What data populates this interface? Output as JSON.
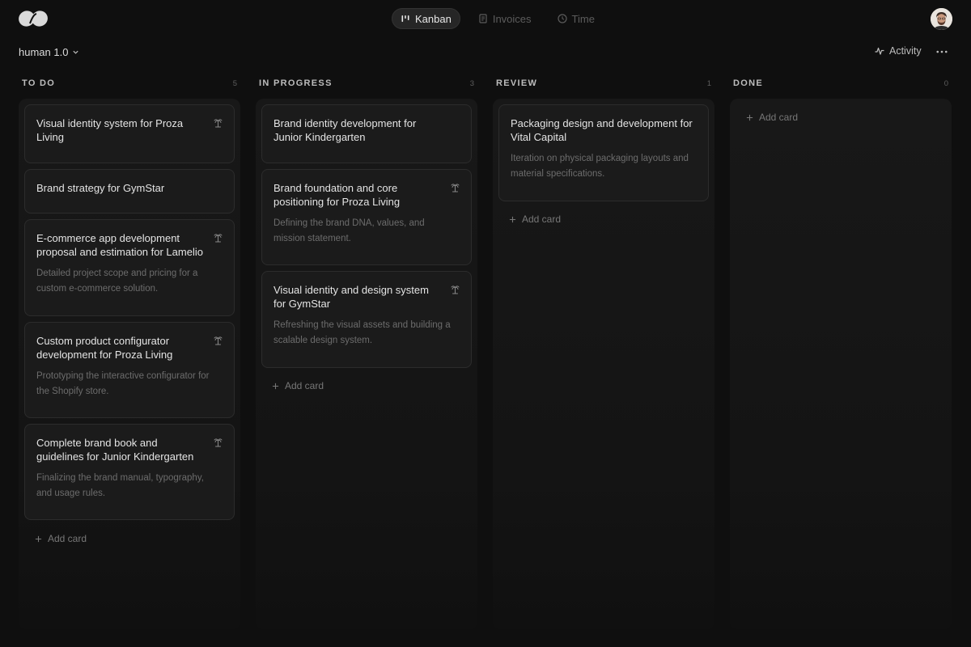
{
  "nav": {
    "kanban": "Kanban",
    "invoices": "Invoices",
    "time": "Time"
  },
  "workspace": {
    "name": "human 1.0"
  },
  "toolbar": {
    "activity": "Activity"
  },
  "columns": [
    {
      "title": "TO DO",
      "count": "5",
      "add_label": "Add card",
      "cards": [
        {
          "title": "Visual identity system for Proza Living",
          "desc": "",
          "icon": "palm-tree-icon"
        },
        {
          "title": "Brand strategy for GymStar",
          "desc": "",
          "icon": ""
        },
        {
          "title": "E-commerce app development proposal and estimation for Lamelio",
          "desc": "Detailed project scope and pricing for a custom e-commerce solution.",
          "icon": "palm-tree-icon"
        },
        {
          "title": "Custom product configurator development for Proza Living",
          "desc": "Prototyping the interactive configurator for the Shopify store.",
          "icon": "palm-tree-icon"
        },
        {
          "title": "Complete brand book and guidelines for Junior Kindergarten",
          "desc": "Finalizing the brand manual, typography, and usage rules.",
          "icon": "palm-tree-icon"
        }
      ]
    },
    {
      "title": "IN PROGRESS",
      "count": "3",
      "add_label": "Add card",
      "cards": [
        {
          "title": "Brand identity development for Junior Kindergarten",
          "desc": "",
          "icon": ""
        },
        {
          "title": "Brand foundation and core positioning for Proza Living",
          "desc": "Defining the brand DNA, values, and mission statement.",
          "icon": "palm-tree-icon"
        },
        {
          "title": "Visual identity and design system for GymStar",
          "desc": "Refreshing the visual assets and building a scalable design system.",
          "icon": "palm-tree-icon"
        }
      ]
    },
    {
      "title": "REVIEW",
      "count": "1",
      "add_label": "Add card",
      "cards": [
        {
          "title": "Packaging design and development for Vital Capital",
          "desc": "Iteration on physical packaging layouts and material specifications.",
          "icon": ""
        }
      ]
    },
    {
      "title": "DONE",
      "count": "0",
      "add_label": "Add card",
      "cards": []
    }
  ]
}
